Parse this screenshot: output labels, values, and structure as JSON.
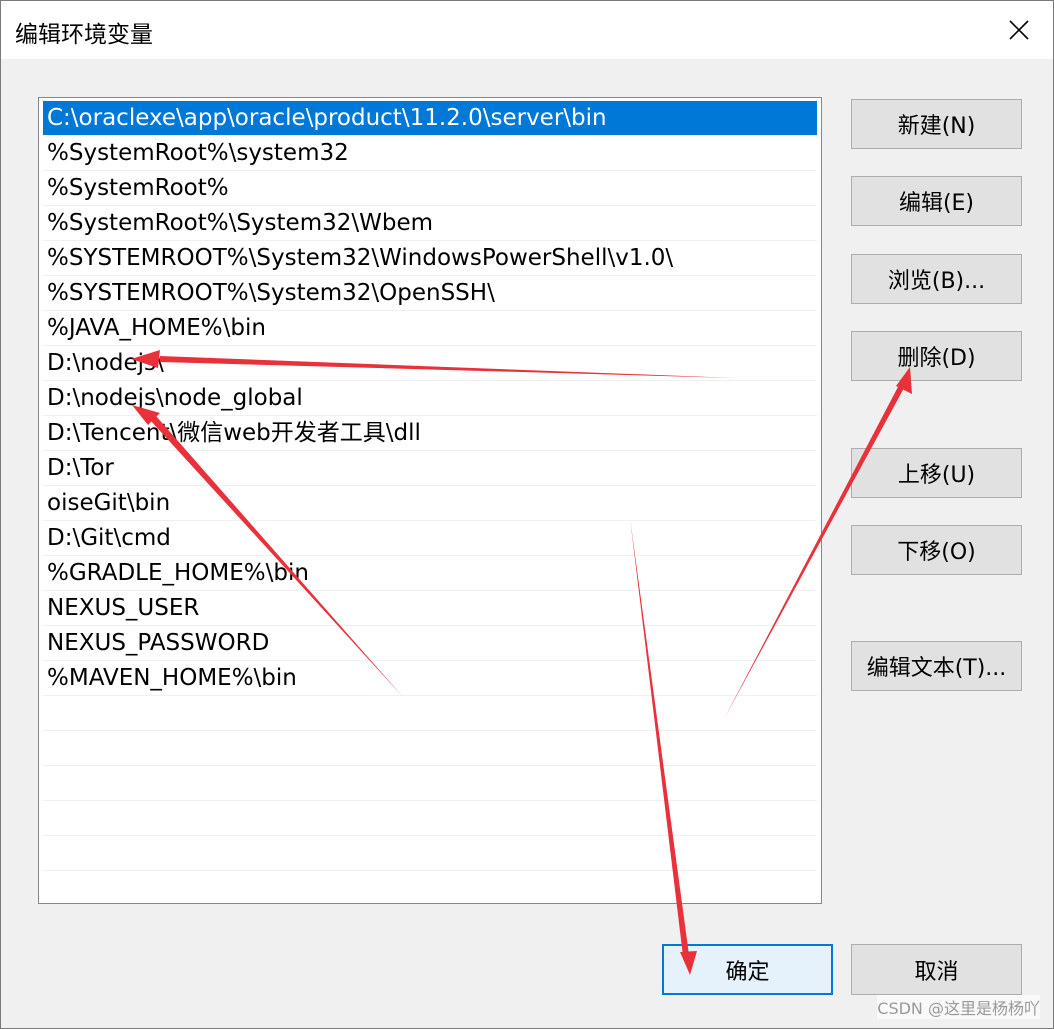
{
  "window": {
    "title": "编辑环境变量",
    "close_icon": "close-icon"
  },
  "list": {
    "selected_index": 0,
    "items": [
      "C:\\oraclexe\\app\\oracle\\product\\11.2.0\\server\\bin",
      "%SystemRoot%\\system32",
      "%SystemRoot%",
      "%SystemRoot%\\System32\\Wbem",
      "%SYSTEMROOT%\\System32\\WindowsPowerShell\\v1.0\\",
      "%SYSTEMROOT%\\System32\\OpenSSH\\",
      "%JAVA_HOME%\\bin",
      "D:\\nodejs\\",
      "D:\\nodejs\\node_global",
      "D:\\Tencent\\微信web开发者工具\\dll",
      "D:\\Tor",
      "oiseGit\\bin",
      "D:\\Git\\cmd",
      "%GRADLE_HOME%\\bin",
      "NEXUS_USER",
      "NEXUS_PASSWORD",
      "%MAVEN_HOME%\\bin"
    ],
    "empty_rows": 6
  },
  "buttons": {
    "new": "新建(N)",
    "edit": "编辑(E)",
    "browse": "浏览(B)...",
    "delete": "删除(D)",
    "move_up": "上移(U)",
    "move_down": "下移(O)",
    "edit_text": "编辑文本(T)...",
    "ok": "确定",
    "cancel": "取消"
  },
  "watermark": "CSDN @这里是杨杨吖",
  "colors": {
    "selection": "#0078d7",
    "annotation_arrow": "#e8313b",
    "dialog_bg": "#f0f0f0"
  }
}
